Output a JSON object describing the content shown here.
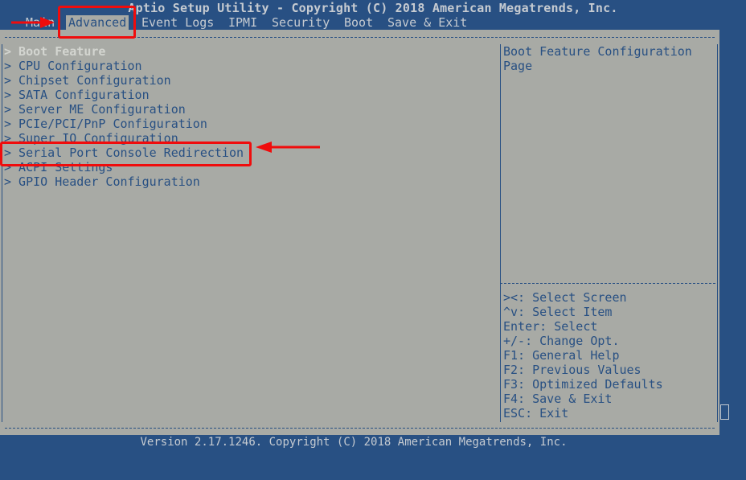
{
  "title": "Aptio Setup Utility - Copyright (C) 2018 American Megatrends, Inc.",
  "tabs": [
    {
      "label": "Main",
      "active": false
    },
    {
      "label": "Advanced",
      "active": true
    },
    {
      "label": "Event Logs",
      "active": false
    },
    {
      "label": "IPMI",
      "active": false
    },
    {
      "label": "Security",
      "active": false
    },
    {
      "label": "Boot",
      "active": false
    },
    {
      "label": "Save & Exit",
      "active": false
    }
  ],
  "menu": {
    "prefix": "> ",
    "items": [
      {
        "label": "> Boot Feature",
        "selected": true
      },
      {
        "label": "> CPU Configuration"
      },
      {
        "label": "> Chipset Configuration"
      },
      {
        "label": "> SATA Configuration"
      },
      {
        "label": "> Server ME Configuration"
      },
      {
        "label": "> PCIe/PCI/PnP Configuration"
      },
      {
        "label": "> Super IO Configuration"
      },
      {
        "label": "> Serial Port Console Redirection",
        "highlighted": true
      },
      {
        "label": "> ACPI Settings"
      },
      {
        "label": "> GPIO Header Configuration"
      }
    ]
  },
  "help": {
    "description": [
      "Boot Feature Configuration",
      "Page"
    ],
    "keys": [
      "><: Select Screen",
      "^v: Select Item",
      "Enter: Select",
      "+/-: Change Opt.",
      "F1: General Help",
      "F2: Previous Values",
      "F3: Optimized Defaults",
      "F4: Save & Exit",
      "ESC: Exit"
    ]
  },
  "footer": "Version 2.17.1246. Copyright (C) 2018 American Megatrends, Inc.",
  "colors": {
    "background": "#285083",
    "panel": "#a8aaa5",
    "text": "#285083",
    "header_text": "#c6cbd1",
    "selected_text": "#d3d5d0",
    "annotation": "#f00c0c"
  }
}
